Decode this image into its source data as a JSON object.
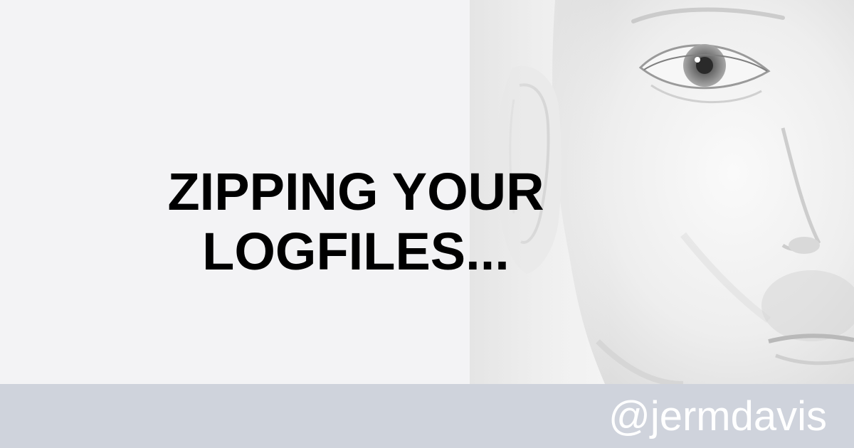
{
  "title": {
    "line1": "ZIPPING YOUR",
    "line2": "LOGFILES..."
  },
  "author_handle": "@jermdavis",
  "colors": {
    "background": "#f3f3f5",
    "footer": "#cfd3dc",
    "title_text": "#000000",
    "handle_text": "#ffffff"
  },
  "image": {
    "description_icon": "face-photo"
  }
}
